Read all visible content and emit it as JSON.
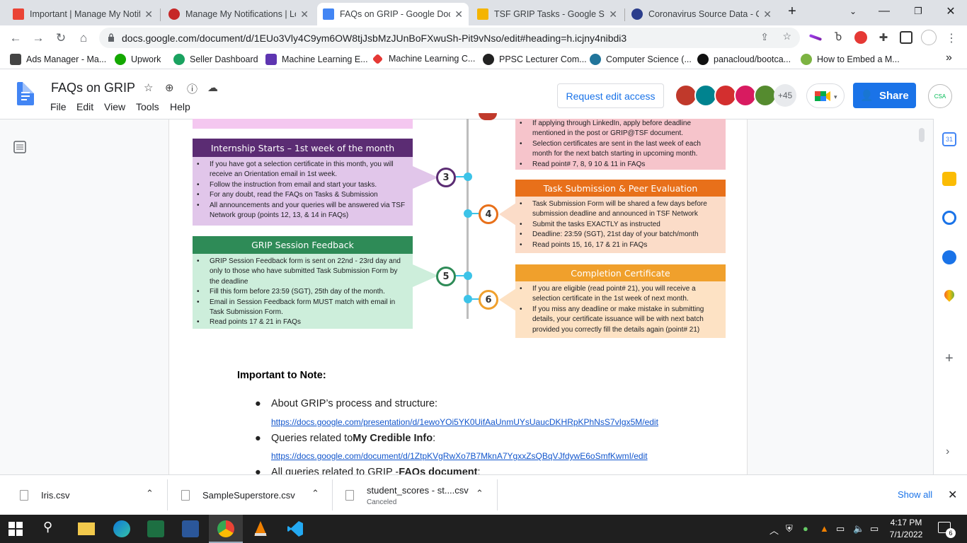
{
  "browser": {
    "tabs": [
      {
        "title": "Important | Manage My Notific",
        "favicon_color": "#ea4335",
        "active": false
      },
      {
        "title": "Manage My Notifications | Lo",
        "favicon_color": "#c62828",
        "active": false
      },
      {
        "title": "FAQs on GRIP - Google Docs",
        "favicon_color": "#4285f4",
        "active": true
      },
      {
        "title": "TSF GRIP Tasks - Google Slid",
        "favicon_color": "#f4b400",
        "active": false
      },
      {
        "title": "Coronavirus Source Data - O",
        "favicon_color": "#2c3e8c",
        "active": false
      }
    ],
    "new_tab_label": "+",
    "url": "docs.google.com/document/d/1EUo3Vly4C9ym6OW8tjJsbMzJUnBoFXwuSh-Pit9vNso/edit#heading=h.icjny4nibdi3",
    "bookmarks": [
      {
        "label": "Ads Manager - Ma...",
        "color": "#444"
      },
      {
        "label": "Upwork",
        "color": "#14a800"
      },
      {
        "label": "Seller Dashboard",
        "color": "#1aa260"
      },
      {
        "label": "Machine Learning E...",
        "color": "#5e35b1"
      },
      {
        "label": "Machine Learning C...",
        "color": "#e53935"
      },
      {
        "label": "PPSC Lecturer Com...",
        "color": "#222"
      },
      {
        "label": "Computer Science (...",
        "color": "#21759b"
      },
      {
        "label": "panacloud/bootca...",
        "color": "#111"
      },
      {
        "label": "How to Embed a M...",
        "color": "#7cb342"
      }
    ],
    "bookmarks_more": "»"
  },
  "docs": {
    "title": "FAQs on GRIP",
    "menu": [
      "File",
      "Edit",
      "View",
      "Tools",
      "Help"
    ],
    "request_edit": "Request edit access",
    "collaborators_extra": "+45",
    "share_label": "Share",
    "account_text": "CSA"
  },
  "infographic": {
    "boxes": [
      {
        "key": "internship",
        "title": "Internship Starts – 1st week of the month",
        "head_color": "#5b2c73",
        "body_color": "#e1c6ea",
        "items": [
          "If you have got a selection certificate in this month, you will receive an Orientation email in 1st week.",
          "Follow the instruction from email and start your tasks.",
          "For any doubt, read the FAQs on Tasks & Submission",
          "All announcements and your queries will be answered via TSF Network group (points 12, 13, & 14 in FAQs)"
        ]
      },
      {
        "key": "feedback",
        "title": "GRIP Session Feedback",
        "head_color": "#2e8b57",
        "body_color": "#cdeedb",
        "items": [
          "GRIP Session Feedback form is sent on 22nd - 23rd day and only to those who have submitted Task Submission Form by the deadline",
          "Fill this form before 23:59 (SGT), 25th day of the month.",
          "Email in Session Feedback form MUST match with email in Task Submission Form.",
          "Read points 17 & 21 in FAQs"
        ]
      },
      {
        "key": "selection",
        "title": "",
        "head_color": "#c0392b",
        "body_color": "#f6c4cb",
        "items": [
          "If applying through LinkedIn, apply before deadline mentioned in the post or GRIP@TSF document.",
          "Selection certificates are sent in the last week of each month for the next batch starting in upcoming month.",
          "Read point# 7, 8, 9 10 & 11 in FAQs"
        ]
      },
      {
        "key": "tasks",
        "title": "Task Submission & Peer Evaluation",
        "head_color": "#e8701a",
        "body_color": "#fbdcc8",
        "items": [
          "Task Submission Form will be shared a few days before submission deadline and announced in TSF Network",
          "Submit the tasks EXACTLY as instructed",
          "Deadline: 23:59 (SGT), 21st day of your batch/month",
          "Read points 15, 16, 17 & 21 in FAQs"
        ]
      },
      {
        "key": "certificate",
        "title": "Completion Certificate",
        "head_color": "#f0a02c",
        "body_color": "#fde2c4",
        "items": [
          "If you are eligible (read point# 21), you will receive a selection certificate in the 1st week of next month.",
          "If you miss any deadline or make mistake in submitting details, your certificate issuance will be with next batch provided you correctly fill the details again (point# 21)"
        ]
      }
    ],
    "steps": [
      {
        "num": "3",
        "color": "#5b2c73"
      },
      {
        "num": "4",
        "color": "#e8701a"
      },
      {
        "num": "5",
        "color": "#2e8b57"
      },
      {
        "num": "6",
        "color": "#f0a02c"
      }
    ]
  },
  "notes": {
    "heading": "Important to Note:",
    "items": [
      {
        "prefix": "About GRIP’s process and structure:",
        "bold": "",
        "suffix": "",
        "link": "https://docs.google.com/presentation/d/1ewoYOi5YK0UifAaUnmUYsUaucDKHRpKPhNsS7vIgx5M/edit"
      },
      {
        "prefix": "Queries related to ",
        "bold": "My Credible Info",
        "suffix": ":",
        "link": "https://docs.google.com/document/d/1ZtpKVgRwXo7B7MknA7YgxxZsQBqVJfdywE6oSmfKwmI/edit"
      },
      {
        "prefix": "All queries related to GRIP - ",
        "bold": "FAQs document",
        "suffix": ":",
        "link": ""
      }
    ]
  },
  "downloads": {
    "items": [
      {
        "name": "Iris.csv",
        "status": ""
      },
      {
        "name": "SampleSuperstore.csv",
        "status": ""
      },
      {
        "name": "student_scores - st....csv",
        "status": "Canceled"
      }
    ],
    "show_all": "Show all"
  },
  "taskbar": {
    "time": "4:17 PM",
    "date": "7/1/2022",
    "notif_count": "6"
  }
}
